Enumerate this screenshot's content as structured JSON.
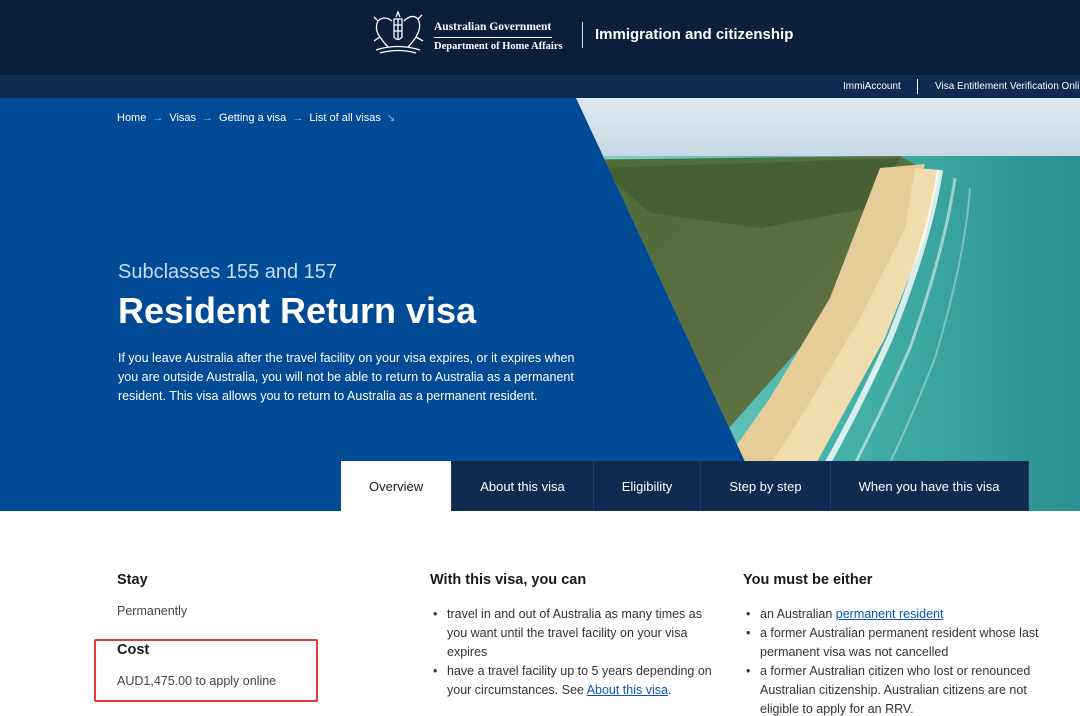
{
  "header": {
    "gov_line1": "Australian Government",
    "gov_line2": "Department of Home Affairs",
    "site_title": "Immigration and citizenship"
  },
  "subnav": {
    "immiaccount": "ImmiAccount",
    "vevo": "Visa Entitlement Verification Online"
  },
  "breadcrumb": [
    "Home",
    "Visas",
    "Getting a visa",
    "List of all visas"
  ],
  "hero": {
    "subclass": "Subclasses 155 and 157",
    "title": "Resident Return visa",
    "description": "If you leave Australia after the travel facility on your visa expires, or it expires when you are outside Australia, you will not be able to return to Australia as a permanent resident. This visa allows you to return to Australia as a permanent resident."
  },
  "tabs": [
    "Overview",
    "About this visa",
    "Eligibility",
    "Step by step",
    "When you have this visa"
  ],
  "stay": {
    "heading": "Stay",
    "value": "Permanently"
  },
  "cost": {
    "heading": "Cost",
    "value": "AUD1,475.00 to apply online"
  },
  "with_visa": {
    "heading": "With this visa, you can",
    "item1": "travel in and out of Australia as many times as you want until the travel facility on your visa expires",
    "item2_pre": "have a travel facility up to 5 years depending on your circumstances. See ",
    "item2_link": "About this visa",
    "item2_post": "."
  },
  "must_be": {
    "heading": "You must be either",
    "item1_pre": "an Australian ",
    "item1_link": "permanent resident",
    "item2": "a former Australian permanent resident whose last permanent visa was not cancelled",
    "item3": "a former Australian citizen who lost or renounced Australian citizenship. Australian citizens are not eligible to apply for an RRV."
  },
  "colors": {
    "header_navy": "#0b1e3c",
    "hero_blue": "#004a96",
    "link_blue": "#0a57b5",
    "highlight_red": "#e53935"
  }
}
